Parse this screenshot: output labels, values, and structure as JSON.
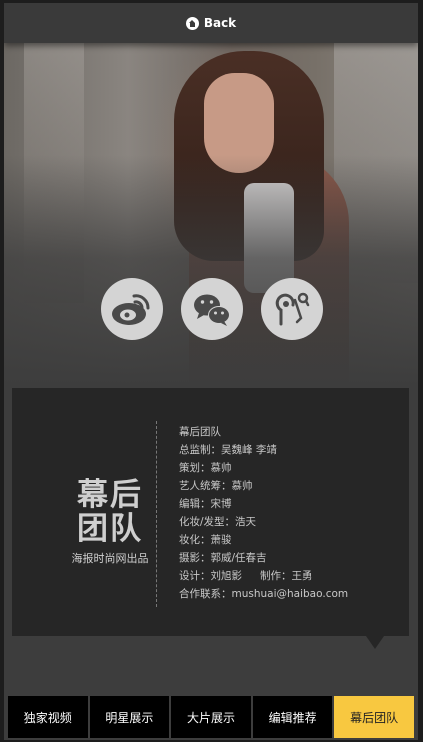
{
  "header": {
    "back_label": "Back",
    "back_icon": "home-icon"
  },
  "social": [
    {
      "name": "weibo",
      "icon": "weibo-icon"
    },
    {
      "name": "wechat",
      "icon": "wechat-icon"
    },
    {
      "name": "listen",
      "icon": "earphone-icon"
    }
  ],
  "card": {
    "brand_line1": "幕后",
    "brand_line2": "团队",
    "brand_sub": "海报时尚网出品",
    "credits": [
      "幕后团队",
      "总监制：吴魏峰 李靖",
      "策划：慕帅",
      "艺人统筹：慕帅",
      "编辑：宋博",
      "化妆/发型：浩天",
      "妆化：萧骏",
      "摄影：郭威/任春吉",
      "合作联系：mushuai@haibao.com"
    ],
    "design_credit": "设计：刘旭影",
    "production_credit": "制作：王勇"
  },
  "nav": {
    "items": [
      "独家视频",
      "明星展示",
      "大片展示",
      "编辑推荐",
      "幕后团队"
    ],
    "active_index": 4
  },
  "colors": {
    "active_tab": "#f8c840",
    "tab_bg": "#000000",
    "card_bg": "#262626",
    "frame_bg": "#3d3d3d"
  }
}
